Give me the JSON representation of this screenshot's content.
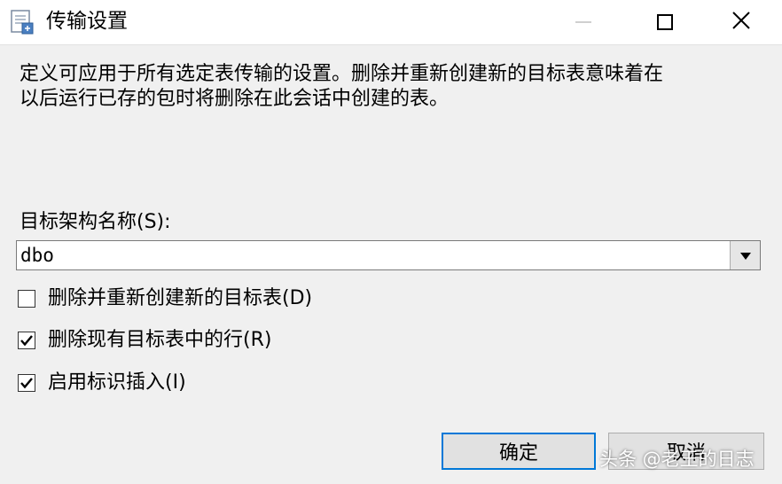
{
  "window": {
    "title": "传输设置",
    "icon": "dialog-settings-icon",
    "controls": [
      "minimize-icon",
      "maximize-icon",
      "close-icon"
    ]
  },
  "description": {
    "line1": "定义可应用于所有选定表传输的设置。删除并重新创建新的目标表意味着在",
    "line2": "以后运行已存的包时将删除在此会话中创建的表。"
  },
  "schema": {
    "label": "目标架构名称(S):",
    "value": "dbo"
  },
  "options": [
    {
      "label": "删除并重新创建新的目标表(D)",
      "checked": false
    },
    {
      "label": "删除现有目标表中的行(R)",
      "checked": true
    },
    {
      "label": "启用标识插入(I)",
      "checked": true
    }
  ],
  "buttons": {
    "ok": "确定",
    "cancel": "取消"
  },
  "watermark": "头条 @老王的日志",
  "colors": {
    "dialog_bg": "#f0f0f0",
    "focus_border": "#0078d7"
  }
}
